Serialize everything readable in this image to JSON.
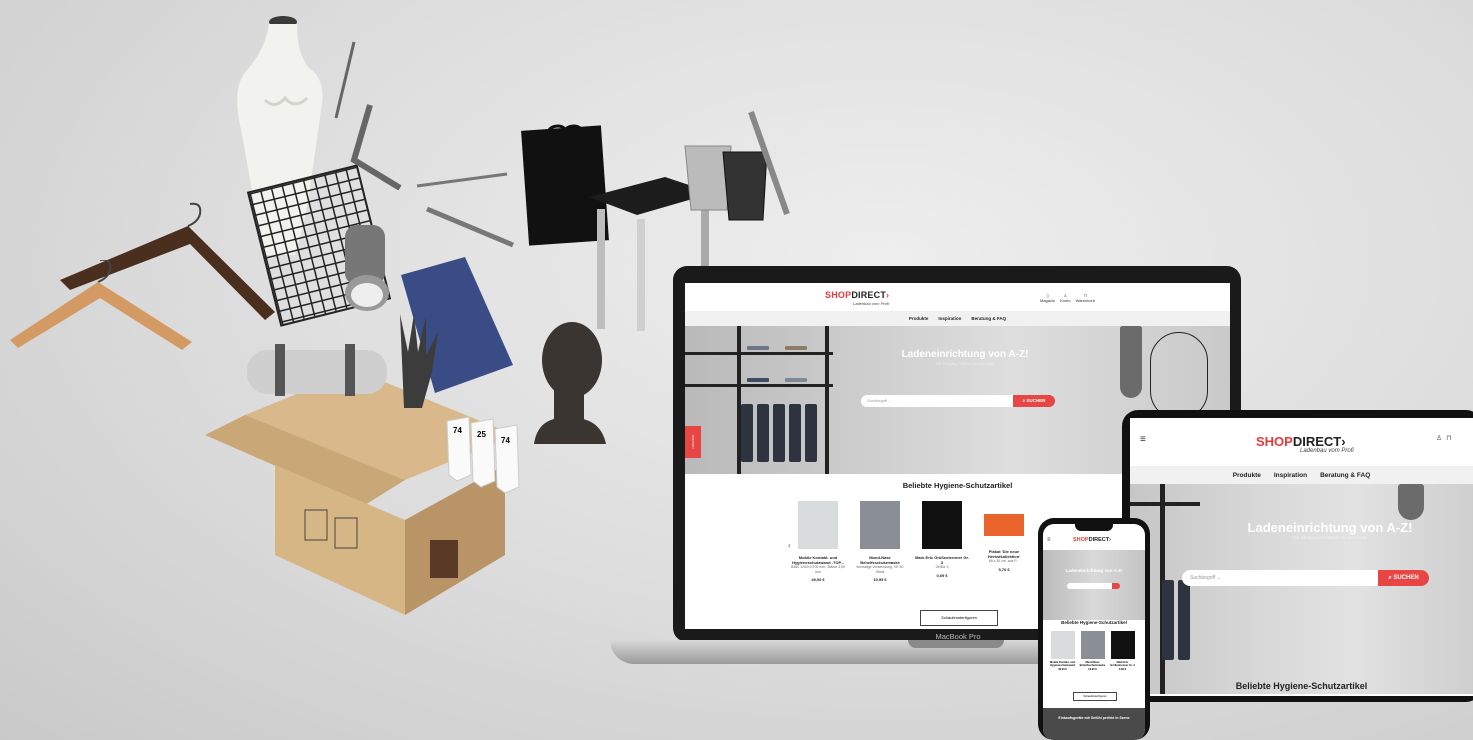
{
  "scene": "shopdirect-device-mockup",
  "brand": {
    "logo_red": "SHOP",
    "logo_dark": "DIRECT",
    "logo_chevron": "›",
    "tagline": "Ladenbau vom Profi",
    "accent_color": "#e84545"
  },
  "laptop": {
    "brand_label": "MacBook Pro",
    "header_icons": [
      {
        "icon": "magazine-icon",
        "label": "Magazin"
      },
      {
        "icon": "account-icon",
        "label": "Konto"
      },
      {
        "icon": "cart-icon",
        "label": "Warenkorb"
      }
    ],
    "nav": [
      "Produkte",
      "Inspiration",
      "Beratung & FAQ"
    ],
    "hero_title": "Ladeneinrichtung von A-Z!",
    "hero_subtitle": "Die Shopping-Plattform für den Ketail",
    "search_placeholder": "Suchbegriff ...",
    "search_button": "SUCHEN",
    "side_tab": "KONTAKT",
    "section_title": "Beliebte Hygiene-Schutzartikel",
    "products": [
      {
        "name": "Mobile Kontakt- und Hygieneschutzwand -TOP...",
        "desc": "B450 1200×H700 mm, Stärke 3,00 mm",
        "price": "49,00 €"
      },
      {
        "name": "Mund-Nase Behelfsschutzmaske",
        "desc": "einmalige Verwendung, VE 50 Stück",
        "price": "19,95 €"
      },
      {
        "name": "Mark Eric Größentrenner Gr. 3",
        "desc": "Größe 3",
        "price": "0,69 €"
      },
      {
        "name": "Plakat 'Die neue Herbstkollektion'",
        "desc": "68 x 30 cm, aus P...",
        "price": "5,70 €"
      }
    ],
    "more_button": "Schaufensterfiguren"
  },
  "tablet": {
    "nav": [
      "Produkte",
      "Inspiration",
      "Beratung & FAQ"
    ],
    "hero_title": "Ladeneinrichtung von A-Z!",
    "hero_subtitle": "Die Shopping-Plattform für den Retail",
    "search_placeholder": "Suchbegriff ...",
    "search_button": "SUCHEN",
    "section_title": "Beliebte Hygiene-Schutzartikel"
  },
  "phone": {
    "hero_title": "Ladeneinrichtung von A-Z!",
    "section_title": "Beliebte Hygiene-Schutzartikel",
    "products": [
      {
        "name": "Mobile Kontakt- und Hygieneschutzwand",
        "price": "49,00 €"
      },
      {
        "name": "Mund-Nase Behelfsschutzmaske",
        "price": "19,95 €"
      },
      {
        "name": "Mark Eric Größentrenner Gr. 3",
        "price": "0,69 €"
      }
    ],
    "more_button": "Schaufensterfiguren",
    "footer_text": "Einkaufsgeräte mit Gefühl perfekt in Szene"
  },
  "box_price_tags": [
    "74",
    "25",
    "74"
  ]
}
